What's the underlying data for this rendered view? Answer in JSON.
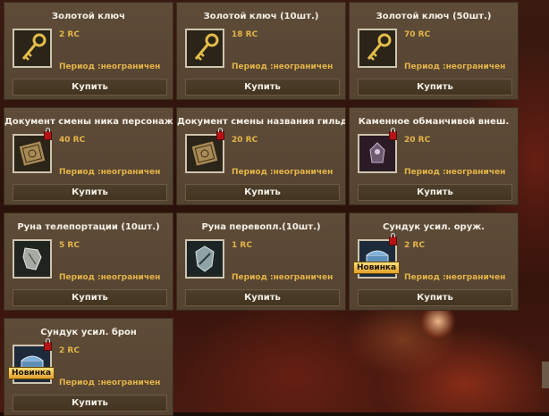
{
  "shop": {
    "buy_label": "Купить",
    "new_badge_label": "Новинка",
    "items": [
      {
        "title": "Золотой ключ",
        "price": "2 RC",
        "period": "Период :неограничен",
        "icon": "golden-key-icon",
        "locked": false,
        "is_new": false
      },
      {
        "title": "Золотой ключ  (10шт.)",
        "price": "18 RC",
        "period": "Период :неограничен",
        "icon": "golden-key-icon",
        "locked": false,
        "is_new": false
      },
      {
        "title": "Золотой ключ  (50шт.)",
        "price": "70 RC",
        "period": "Период :неограничен",
        "icon": "golden-key-icon",
        "locked": false,
        "is_new": false
      },
      {
        "title": "Документ смены ника персонажа",
        "price": "40 RC",
        "period": "Период :неограничен",
        "icon": "document-icon",
        "locked": true,
        "is_new": false
      },
      {
        "title": "Документ смены названия гильд",
        "price": "20 RC",
        "period": "Период :неограничен",
        "icon": "document-icon",
        "locked": true,
        "is_new": false
      },
      {
        "title": "Каменное обманчивой внеш.",
        "price": "20 RC",
        "period": "Период :неограничен",
        "icon": "stone-icon",
        "locked": true,
        "is_new": false
      },
      {
        "title": "Руна телепортации (10шт.)",
        "price": "5 RC",
        "period": "Период :неограничен",
        "icon": "rune-icon",
        "locked": false,
        "is_new": false
      },
      {
        "title": "Руна перевопл.(10шт.)",
        "price": "1 RC",
        "period": "Период :неограничен",
        "icon": "rune-icon",
        "locked": false,
        "is_new": false
      },
      {
        "title": "Сундук усил. оруж.",
        "price": "2 RC",
        "period": "Период :неограничен",
        "icon": "chest-icon",
        "locked": true,
        "is_new": true
      },
      {
        "title": "Сундук усил. брон",
        "price": "2 RC",
        "period": "Период :неограничен",
        "icon": "chest-icon",
        "locked": true,
        "is_new": true
      }
    ]
  },
  "colors": {
    "price_text": "#e4b449",
    "card_bg": "#5e4c39",
    "new_badge": "#f2c14e",
    "lock": "#b51414"
  }
}
